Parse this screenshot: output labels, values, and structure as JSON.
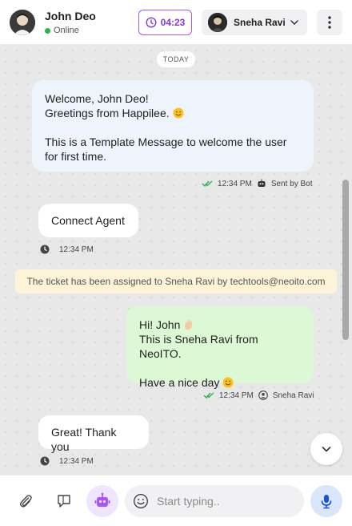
{
  "header": {
    "user_name": "John Deo",
    "user_status": "Online",
    "timer": "04:23",
    "agent_name": "Sneha Ravi",
    "icons": {
      "timer": "clock-icon",
      "agent_dropdown": "chevron-down-icon",
      "more": "more-vertical-icon"
    }
  },
  "chat": {
    "day_label": "TODAY",
    "bot_message": {
      "lines": [
        "Welcome, John Deo!",
        "Greetings from Happilee.",
        "This is a Template Message to welcome the user",
        "for first time."
      ],
      "time": "12:34 PM",
      "sender": "Sent by Bot"
    },
    "connect_message": {
      "text": "Connect Agent",
      "time": "12:34 PM"
    },
    "system_banner": "The ticket has been assigned to Sneha Ravi by techtools@neoito.com",
    "agent_message": {
      "lines": [
        "Hi! John",
        "This is Sneha Ravi from NeoITO.",
        "Have a nice day"
      ],
      "time": "12:34 PM",
      "sender": "Sneha Ravi"
    },
    "thanks_message": {
      "text": "Great! Thank you",
      "time": "12:34 PM"
    }
  },
  "composer": {
    "placeholder": "Start typing.."
  },
  "colors": {
    "accent": "#7c3aed",
    "online": "#2bb24c",
    "incoming_bubble": "#ffffff",
    "outgoing_bubble": "#dcf8d4",
    "bot_bubble": "#eef4fb",
    "banner": "#fdf3d6"
  }
}
